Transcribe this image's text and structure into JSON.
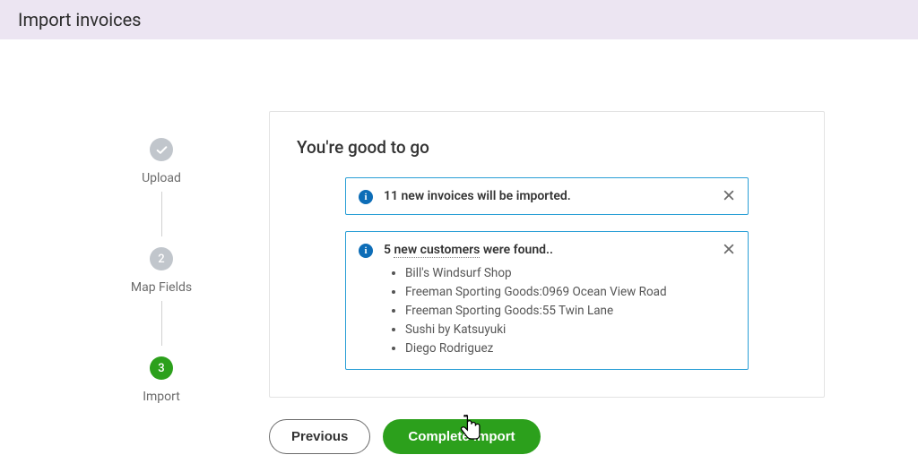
{
  "header": {
    "title": "Import invoices"
  },
  "stepper": {
    "steps": [
      {
        "num": "",
        "label": "Upload",
        "state": "done"
      },
      {
        "num": "2",
        "label": "Map Fields",
        "state": "inactive"
      },
      {
        "num": "3",
        "label": "Import",
        "state": "active"
      }
    ]
  },
  "panel": {
    "title": "You're good to go",
    "alerts": [
      {
        "id": "invoices",
        "text": "11 new invoices will be imported.",
        "items": []
      },
      {
        "id": "customers",
        "text_prefix": "5 ",
        "text_underlined": "new customers",
        "text_suffix": " were found..",
        "items": [
          "Bill's Windsurf Shop",
          "Freeman Sporting Goods:0969 Ocean View Road",
          "Freeman Sporting Goods:55 Twin Lane",
          "Sushi by Katsuyuki",
          "Diego Rodriguez"
        ]
      }
    ]
  },
  "buttons": {
    "previous": "Previous",
    "complete": "Complete import"
  }
}
